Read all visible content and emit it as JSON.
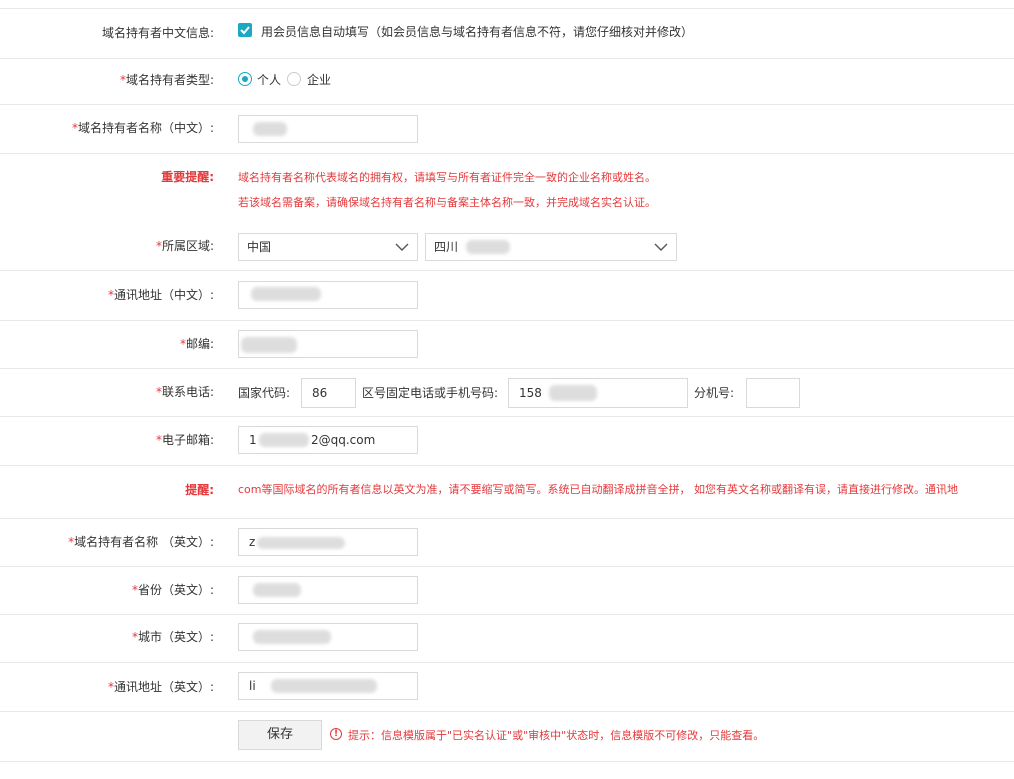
{
  "auto_fill": {
    "label": "域名持有者中文信息:",
    "checkbox_label": "用会员信息自动填写（如会员信息与域名持有者信息不符，请您仔细核对并修改）",
    "checked": true
  },
  "type": {
    "label": "域名持有者类型:",
    "options": [
      "个人",
      "企业"
    ],
    "selected": "个人"
  },
  "name_cn": {
    "label": "域名持有者名称（中文）:"
  },
  "important": {
    "label": "重要提醒:",
    "line1": "域名持有者名称代表域名的拥有权，请填写与所有者证件完全一致的企业名称或姓名。",
    "line2": "若该域名需备案，请确保域名持有者名称与备案主体名称一致，并完成域名实名认证。"
  },
  "region": {
    "label": "所属区域:",
    "country": "中国",
    "province": "四川"
  },
  "address_cn": {
    "label": "通讯地址（中文）:"
  },
  "postcode": {
    "label": "邮编:"
  },
  "phone": {
    "label": "联系电话:",
    "country_code_label": "国家代码:",
    "country_code": "86",
    "number_label": "区号固定电话或手机号码:",
    "number": "158",
    "ext_label": "分机号:",
    "ext": ""
  },
  "email": {
    "label": "电子邮箱:",
    "value_prefix": "1",
    "value_suffix": "2@qq.com"
  },
  "reminder": {
    "label": "提醒:",
    "text": "com等国际域名的所有者信息以英文为准，请不要缩写或简写。系统已自动翻译成拼音全拼， 如您有英文名称或翻译有误，请直接进行修改。通讯地"
  },
  "name_en": {
    "label": "域名持有者名称  （英文）:",
    "value": "z"
  },
  "province_en": {
    "label": "省份（英文）:"
  },
  "city_en": {
    "label": "城市（英文）:"
  },
  "address_en": {
    "label": "通讯地址（英文）:",
    "value": "li"
  },
  "footer": {
    "save_label": "保存",
    "tip_text": "提示：信息模版属于\"已实名认证\"或\"审核中\"状态时，信息模版不可修改，只能查看。"
  },
  "colors": {
    "accent": "#1ba8c4",
    "required": "#e4393c",
    "border": "#d9d9d9"
  }
}
